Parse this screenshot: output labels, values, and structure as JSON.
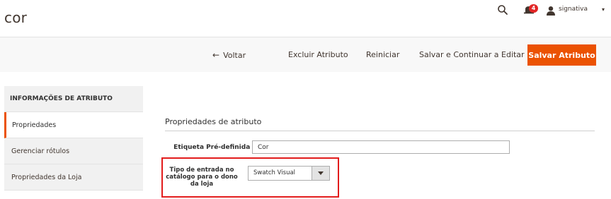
{
  "page": {
    "title": "cor"
  },
  "header": {
    "notifications_count": "4",
    "user_name": "signativa",
    "user_caret": "▾"
  },
  "toolbar": {
    "back_arrow": "←",
    "back_label": "Voltar",
    "delete_label": "Excluir Atributo",
    "reset_label": "Reiniciar",
    "save_continue_label": "Salvar e Continuar a Editar",
    "save_label": "Salvar Atributo"
  },
  "tabs": {
    "title": "INFORMAÇÕES DE ATRIBUTO",
    "items": [
      {
        "label": "Propriedades"
      },
      {
        "label": "Gerenciar rótulos"
      },
      {
        "label": "Propriedades da Loja"
      }
    ]
  },
  "form": {
    "section_title": "Propriedades de atributo",
    "default_label": {
      "label": "Etiqueta Pré-definida",
      "required_mark": "*",
      "value": "Cor"
    },
    "input_type": {
      "label": "Tipo de entrada no catálogo para o dono da loja",
      "value": "Swatch Visual"
    }
  },
  "colors": {
    "accent": "#eb5202",
    "highlight_border": "#e21c1c",
    "badge": "#e22626",
    "text": "#41362f"
  }
}
